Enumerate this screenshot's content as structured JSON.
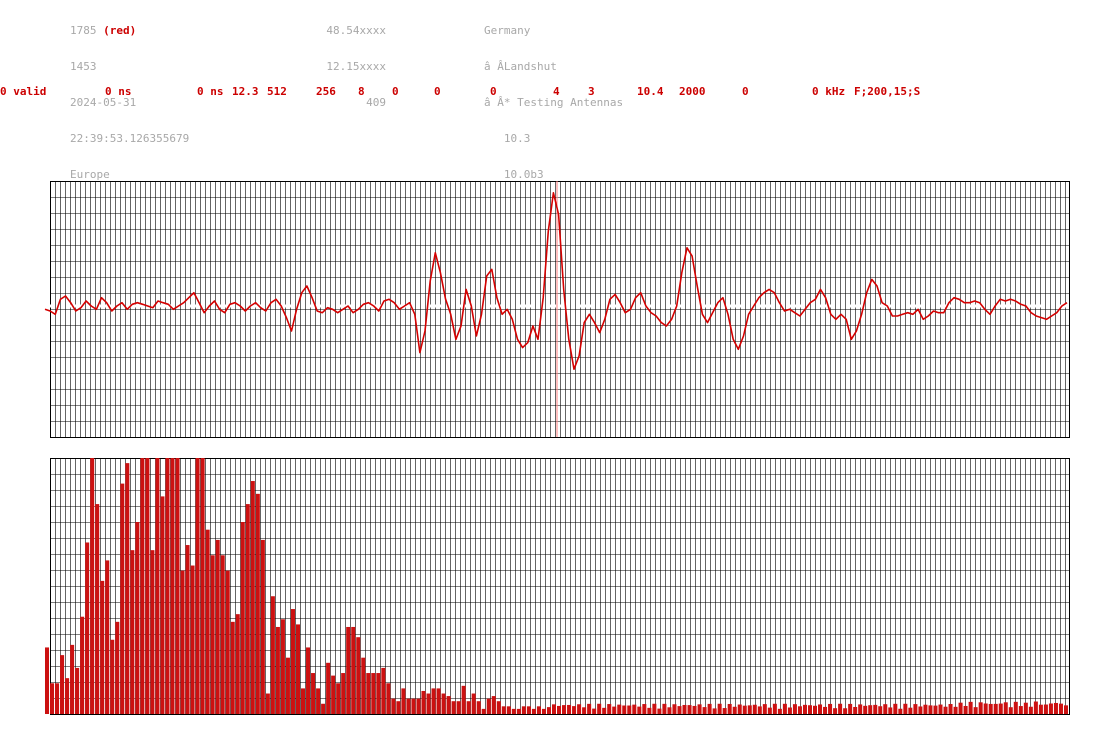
{
  "header": {
    "col1": [
      {
        "text": "1785 ",
        "accent": "(red)"
      },
      {
        "text": "1453"
      },
      {
        "text": "2024-05-31"
      },
      {
        "text": "22:39:53.126355679"
      },
      {
        "text": "Europe"
      }
    ],
    "col2": [
      "48.54xxxx",
      "12.15xxxx",
      "409"
    ],
    "col3": [
      "Germany",
      "â ÂLandshut",
      "â Â* Testing Antennas",
      "   10.3",
      "   10.0b3"
    ]
  },
  "status_bar": [
    "0 valid",
    "0 ns",
    "0 ns",
    "12.3",
    "512",
    "256",
    "8",
    "0",
    "0",
    "0",
    "4",
    "3",
    "10.4",
    "2000",
    "0",
    "0 kHz",
    "F;200,15;S"
  ],
  "colors": {
    "accent": "#cc0000",
    "grid": "#000000",
    "text_grey": "#a8a8a8",
    "trace": "#d40000",
    "bars": "#cc1111"
  },
  "chart_data": [
    {
      "type": "line",
      "description_series": "waveform",
      "ylim": [
        -1,
        1
      ],
      "grid": true,
      "values": [
        -0.02,
        -0.03,
        -0.05,
        0.04,
        0.06,
        0.02,
        -0.03,
        -0.01,
        0.03,
        0.0,
        -0.02,
        0.05,
        0.02,
        -0.03,
        0.0,
        0.02,
        -0.02,
        0.01,
        0.02,
        0.01,
        0.0,
        -0.01,
        0.03,
        0.02,
        0.01,
        -0.02,
        0.0,
        0.02,
        0.05,
        0.08,
        0.02,
        -0.04,
        0.0,
        0.03,
        -0.02,
        -0.04,
        0.01,
        0.02,
        0.0,
        -0.03,
        0.0,
        0.02,
        -0.01,
        -0.03,
        0.02,
        0.04,
        0.0,
        -0.07,
        -0.15,
        -0.02,
        0.08,
        0.12,
        0.05,
        -0.03,
        -0.04,
        -0.01,
        -0.02,
        -0.04,
        -0.02,
        0.0,
        -0.04,
        -0.02,
        0.01,
        0.02,
        0.0,
        -0.03,
        0.03,
        0.04,
        0.02,
        -0.02,
        0.0,
        0.02,
        -0.05,
        -0.28,
        -0.15,
        0.15,
        0.32,
        0.2,
        0.04,
        -0.05,
        -0.2,
        -0.12,
        0.1,
        0.0,
        -0.18,
        -0.05,
        0.18,
        0.22,
        0.05,
        -0.05,
        -0.02,
        -0.08,
        -0.2,
        -0.25,
        -0.22,
        -0.12,
        -0.2,
        0.05,
        0.45,
        0.68,
        0.55,
        0.1,
        -0.2,
        -0.38,
        -0.3,
        -0.1,
        -0.05,
        -0.1,
        -0.16,
        -0.08,
        0.04,
        0.07,
        0.02,
        -0.04,
        -0.02,
        0.05,
        0.08,
        0.0,
        -0.04,
        -0.06,
        -0.1,
        -0.12,
        -0.08,
        0.0,
        0.2,
        0.35,
        0.3,
        0.12,
        -0.05,
        -0.1,
        -0.04,
        0.02,
        0.05,
        -0.05,
        -0.2,
        -0.26,
        -0.18,
        -0.05,
        0.0,
        0.05,
        0.08,
        0.1,
        0.08,
        0.02,
        -0.03,
        -0.02,
        -0.04,
        -0.06,
        -0.02,
        0.02,
        0.04,
        0.1,
        0.05,
        -0.05,
        -0.08,
        -0.05,
        -0.08,
        -0.2,
        -0.15,
        -0.05,
        0.08,
        0.16,
        0.12,
        0.02,
        0.0,
        -0.06,
        -0.06,
        -0.05,
        -0.04,
        -0.05,
        -0.02,
        -0.08,
        -0.06,
        -0.03,
        -0.04,
        -0.04,
        0.02,
        0.05,
        0.04,
        0.02,
        0.02,
        0.03,
        0.02,
        -0.02,
        -0.05,
        0.0,
        0.04,
        0.03,
        0.04,
        0.03,
        0.01,
        0.0,
        -0.04,
        -0.06,
        -0.07,
        -0.08,
        -0.06,
        -0.04,
        0.0,
        0.02
      ]
    },
    {
      "type": "bar",
      "description_series": "spectrum",
      "ylim": [
        0,
        1
      ],
      "grid": true,
      "values": [
        0.26,
        0.12,
        0.12,
        0.23,
        0.14,
        0.27,
        0.18,
        0.38,
        0.67,
        1.0,
        0.82,
        0.52,
        0.6,
        0.29,
        0.36,
        0.9,
        0.98,
        0.64,
        0.75,
        1.0,
        1.0,
        0.64,
        1.0,
        0.85,
        1.0,
        1.0,
        1.0,
        0.56,
        0.66,
        0.58,
        1.0,
        1.0,
        0.72,
        0.62,
        0.68,
        0.62,
        0.56,
        0.36,
        0.39,
        0.75,
        0.82,
        0.91,
        0.86,
        0.68,
        0.08,
        0.46,
        0.34,
        0.37,
        0.22,
        0.41,
        0.35,
        0.1,
        0.26,
        0.16,
        0.1,
        0.04,
        0.2,
        0.15,
        0.12,
        0.16,
        0.34,
        0.34,
        0.3,
        0.22,
        0.16,
        0.16,
        0.16,
        0.18,
        0.12,
        0.06,
        0.05,
        0.1,
        0.06,
        0.06,
        0.06,
        0.09,
        0.08,
        0.1,
        0.1,
        0.08,
        0.07,
        0.05,
        0.05,
        0.11,
        0.05,
        0.08,
        0.05,
        0.02,
        0.06,
        0.07,
        0.05,
        0.03,
        0.03,
        0.02,
        0.02,
        0.03,
        0.03,
        0.02,
        0.03,
        0.02
      ]
    }
  ]
}
